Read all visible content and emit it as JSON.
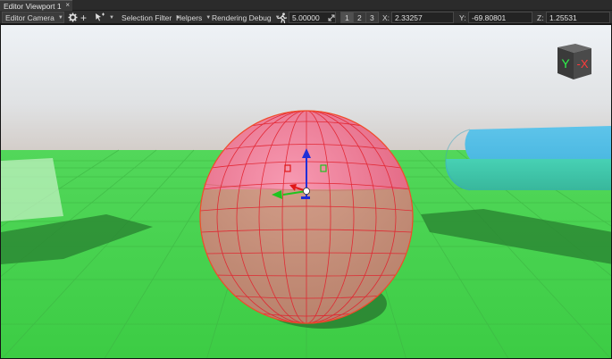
{
  "tab": {
    "title": "Editor Viewport 1",
    "close": "×"
  },
  "toolbar": {
    "camera": "Editor Camera",
    "selection_filter": "Selection Filter",
    "helpers": "Helpers",
    "rendering_debug": "Rendering Debug",
    "speed": "5.00000",
    "view1": "1",
    "view2": "2",
    "view3": "3",
    "x_label": "X:",
    "x_value": "2.33257",
    "y_label": "Y:",
    "y_value": "-69.80801",
    "z_label": "Z:",
    "z_value": "1.25531"
  },
  "orientation_cube": {
    "y_face": "Y",
    "x_face": "-X"
  },
  "colors": {
    "sky_top": "#e7edf2",
    "ground": "#4ad84a",
    "sphere_red": "#ee5a7a",
    "capsule": "#4cc6e0"
  },
  "icons": {
    "gear": "gear-icon",
    "add": "plus-icon",
    "select": "select-cursor-icon",
    "runner": "speed-runner-icon",
    "expand": "expand-arrows-icon"
  }
}
